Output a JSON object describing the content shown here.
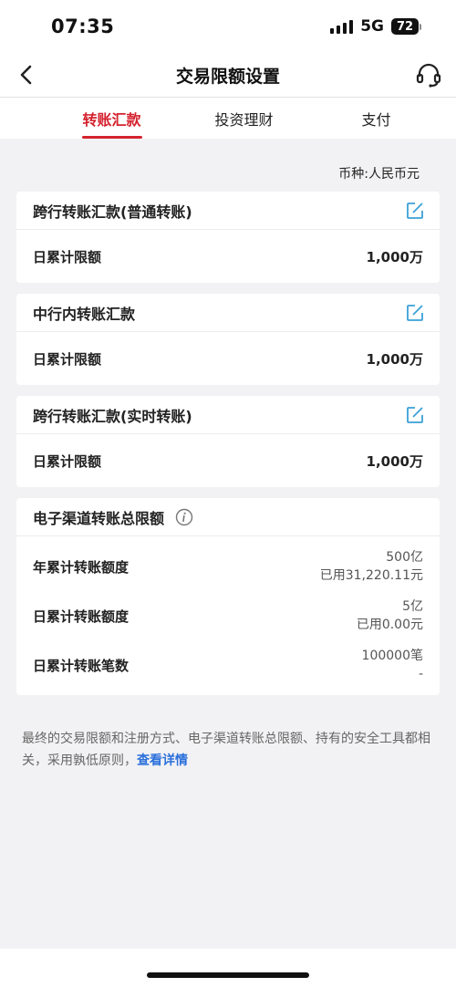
{
  "status": {
    "time": "07:35",
    "network": "5G",
    "battery": "72"
  },
  "nav": {
    "title": "交易限额设置"
  },
  "tabs": [
    {
      "label": "转账汇款",
      "active": true
    },
    {
      "label": "投资理财",
      "active": false
    },
    {
      "label": "支付",
      "active": false
    }
  ],
  "currency": "币种:人民币元",
  "cards": [
    {
      "title": "跨行转账汇款(普通转账)",
      "row_label": "日累计限额",
      "row_value": "1,000万"
    },
    {
      "title": "中行内转账汇款",
      "row_label": "日累计限额",
      "row_value": "1,000万"
    },
    {
      "title": "跨行转账汇款(实时转账)",
      "row_label": "日累计限额",
      "row_value": "1,000万"
    }
  ],
  "total": {
    "title": "电子渠道转账总限额",
    "rows": [
      {
        "label": "年累计转账额度",
        "v1": "500亿",
        "v2": "已用31,220.11元"
      },
      {
        "label": "日累计转账额度",
        "v1": "5亿",
        "v2": "已用0.00元"
      },
      {
        "label": "日累计转账笔数",
        "v1": "100000笔",
        "v2": "-"
      }
    ]
  },
  "note": {
    "text": "最终的交易限额和注册方式、电子渠道转账总限额、持有的安全工具都相关，采用孰低原则，",
    "link": "查看详情"
  },
  "colors": {
    "accent": "#d5232f",
    "link": "#2a6fdb",
    "edit_icon": "#3aa0d8"
  }
}
